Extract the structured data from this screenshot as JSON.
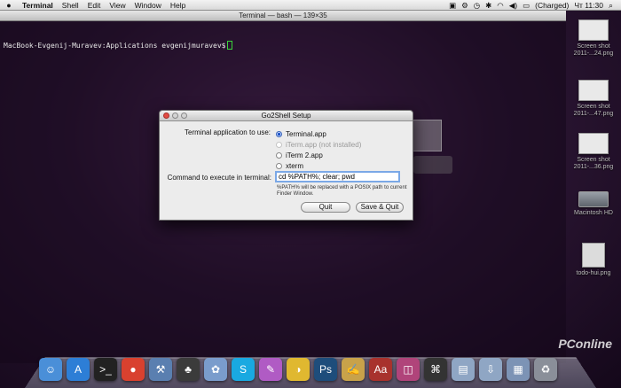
{
  "menubar": {
    "apple": "",
    "items": [
      "Terminal",
      "Shell",
      "Edit",
      "View",
      "Window",
      "Help"
    ],
    "battery": "(Charged)",
    "clock": "Чт 11:30",
    "search_icon": "search-icon"
  },
  "terminal": {
    "title": "Terminal — bash — 139×35",
    "prompt": "MacBook-Evgenij-Muravev:Applications evgenijmuravev$"
  },
  "desktop": {
    "icons": [
      {
        "label": "Screen shot\n2011-...24.png"
      },
      {
        "label": "Screen shot\n2011-...47.png"
      },
      {
        "label": "Screen shot\n2011-...36.png"
      },
      {
        "label": "Macintosh HD"
      },
      {
        "label": "todo-hui.png"
      }
    ]
  },
  "dialog": {
    "title": "Go2Shell Setup",
    "terminal_label": "Terminal application to use:",
    "options": [
      {
        "label": "Terminal.app",
        "selected": true,
        "disabled": false
      },
      {
        "label": "iTerm.app (not installed)",
        "selected": false,
        "disabled": true
      },
      {
        "label": "iTerm 2.app",
        "selected": false,
        "disabled": false
      },
      {
        "label": "xterm",
        "selected": false,
        "disabled": false
      }
    ],
    "command_label": "Command to execute in terminal:",
    "command_value": "cd %PATH%; clear; pwd",
    "hint": "%PATH% will be replaced with a POSIX  path to current Finder Window.",
    "quit_label": "Quit",
    "save_quit_label": "Save & Quit"
  },
  "dock": {
    "icons": [
      {
        "name": "finder-icon",
        "glyph": "☺",
        "color": "#4a8fd8"
      },
      {
        "name": "app-store-icon",
        "glyph": "A",
        "color": "#2d7ed6"
      },
      {
        "name": "terminal-icon",
        "glyph": ">_",
        "color": "#222222"
      },
      {
        "name": "chrome-icon",
        "glyph": "●",
        "color": "#d9412f"
      },
      {
        "name": "xcode-icon",
        "glyph": "⚒",
        "color": "#5a7fb0"
      },
      {
        "name": "adium-icon",
        "glyph": "♣",
        "color": "#3b3b3b"
      },
      {
        "name": "iphoto-icon",
        "glyph": "✿",
        "color": "#7a9ccc"
      },
      {
        "name": "skype-icon",
        "glyph": "S",
        "color": "#19a9e1"
      },
      {
        "name": "sketch-icon",
        "glyph": "✎",
        "color": "#b05bc4"
      },
      {
        "name": "colorsync-icon",
        "glyph": "◑",
        "color": "#e0b830"
      },
      {
        "name": "photoshop-icon",
        "glyph": "Ps",
        "color": "#1e4d7b"
      },
      {
        "name": "textedit-icon",
        "glyph": "✍",
        "color": "#c8a24a"
      },
      {
        "name": "dictionary-icon",
        "glyph": "Aa",
        "color": "#a8322d"
      },
      {
        "name": "photo-booth-icon",
        "glyph": "◫",
        "color": "#b0447a"
      },
      {
        "name": "go2shell-icon",
        "glyph": "⌘",
        "color": "#333333"
      },
      {
        "name": "documents-stack-icon",
        "glyph": "▤",
        "color": "#8fa6c4"
      },
      {
        "name": "downloads-stack-icon",
        "glyph": "⇩",
        "color": "#8fa6c4"
      },
      {
        "name": "applications-stack-icon",
        "glyph": "▦",
        "color": "#7c93b5"
      },
      {
        "name": "trash-icon",
        "glyph": "♻",
        "color": "#8a8f99"
      }
    ]
  },
  "watermark": "PConline"
}
